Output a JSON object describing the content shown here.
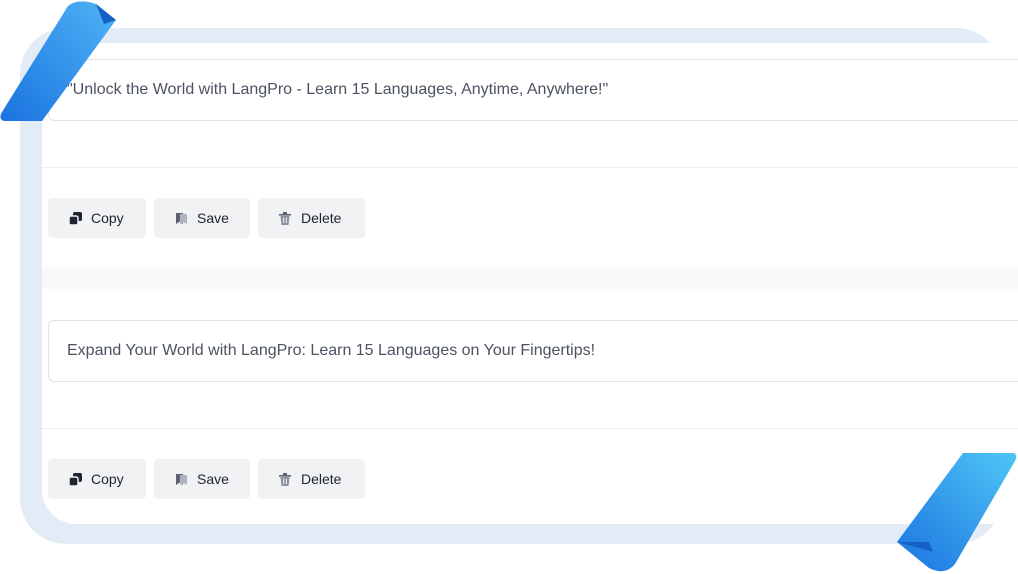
{
  "results": [
    {
      "text": "\"Unlock the World with LangPro - Learn 15 Languages, Anytime, Anywhere!\"",
      "actions": {
        "copy": "Copy",
        "save": "Save",
        "delete": "Delete"
      }
    },
    {
      "text": "Expand Your World with LangPro: Learn 15 Languages on Your Fingertips!",
      "actions": {
        "copy": "Copy",
        "save": "Save",
        "delete": "Delete"
      }
    }
  ],
  "icons": {
    "copy": "copy-icon",
    "save": "bookmark-icon",
    "delete": "trash-icon"
  },
  "colors": {
    "frame": "#e3ecf6",
    "accent": "#2f8ff0",
    "button_bg": "#f1f2f4"
  }
}
